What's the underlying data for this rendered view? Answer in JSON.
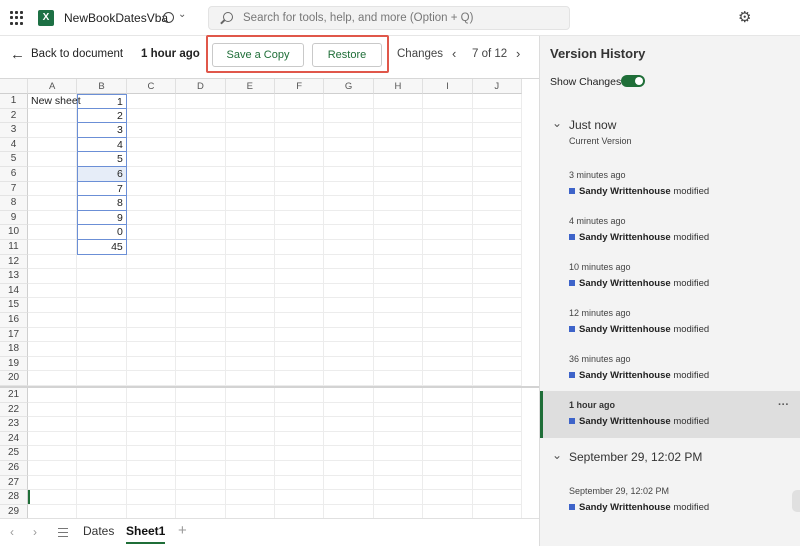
{
  "titlebar": {
    "filename": "NewBookDatesVba",
    "search_placeholder": "Search for tools, help, and more (Option + Q)",
    "app_icon": "excel-logo",
    "cloud_icon": "cloud-sync-icon",
    "settings_icon": "gear-icon"
  },
  "toolbar": {
    "back_label": "Back to document",
    "time_label": "1 hour ago",
    "save_copy_label": "Save a Copy",
    "restore_label": "Restore",
    "changes_label": "Changes",
    "page_count": "7 of 12"
  },
  "sheet": {
    "columns": [
      "A",
      "B",
      "C",
      "D",
      "E",
      "F",
      "G",
      "H",
      "I",
      "J"
    ],
    "rows": [
      "1",
      "2",
      "3",
      "4",
      "5",
      "6",
      "7",
      "8",
      "9",
      "10",
      "11",
      "12",
      "13",
      "14",
      "15",
      "16",
      "17",
      "18",
      "19",
      "20",
      "21",
      "22",
      "23",
      "24",
      "25",
      "26",
      "27",
      "28",
      "29"
    ],
    "a1": "New sheet",
    "b_values": [
      "1",
      "2",
      "3",
      "4",
      "5",
      "6",
      "7",
      "8",
      "9",
      "0",
      "45"
    ]
  },
  "tabs": {
    "dates": "Dates",
    "sheet1": "Sheet1",
    "add": "+"
  },
  "panel": {
    "title": "Version History",
    "show_changes": "Show Changes",
    "group1_title": "Just now",
    "group1_sub": "Current Version",
    "group2_title": "September 29, 12:02 PM",
    "entries": [
      {
        "time": "3 minutes ago",
        "user": "Sandy Writtenhouse",
        "action": "modified"
      },
      {
        "time": "4 minutes ago",
        "user": "Sandy Writtenhouse",
        "action": "modified"
      },
      {
        "time": "10 minutes ago",
        "user": "Sandy Writtenhouse",
        "action": "modified"
      },
      {
        "time": "12 minutes ago",
        "user": "Sandy Writtenhouse",
        "action": "modified"
      },
      {
        "time": "36 minutes ago",
        "user": "Sandy Writtenhouse",
        "action": "modified"
      },
      {
        "time": "1 hour ago",
        "user": "Sandy Writtenhouse",
        "action": "modified"
      },
      {
        "time": "September 29, 12:02 PM",
        "user": "Sandy Writtenhouse",
        "action": "modified"
      }
    ],
    "more_label": "···"
  },
  "colors": {
    "accent_green": "#1f6e38",
    "highlight_red": "#e0574a",
    "author_blue": "#3d63c9"
  }
}
